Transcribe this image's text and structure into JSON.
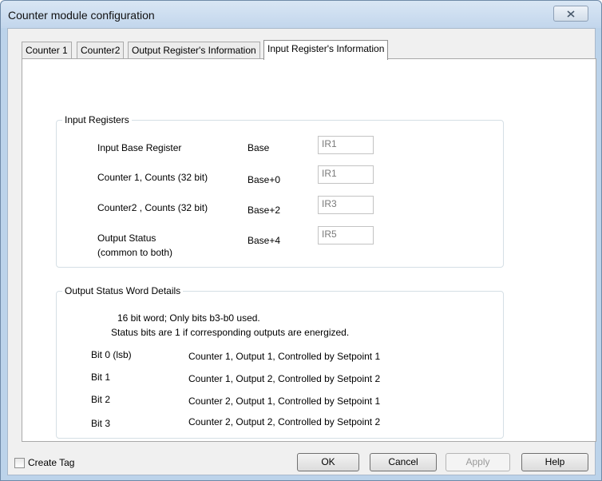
{
  "window": {
    "title": "Counter module configuration"
  },
  "tabs": [
    {
      "label": "Counter 1"
    },
    {
      "label": "Counter2"
    },
    {
      "label": "Output Register's Information"
    },
    {
      "label": "Input Register's Information"
    }
  ],
  "input_registers": {
    "legend": "Input Registers",
    "rows": [
      {
        "label": "Input Base Register",
        "offset": "Base",
        "value": "IR1"
      },
      {
        "label": "Counter 1, Counts (32 bit)",
        "offset": "Base+0",
        "value": "IR1"
      },
      {
        "label": "Counter2 , Counts (32 bit)",
        "offset": "Base+2",
        "value": "IR3"
      },
      {
        "label": "Output Status",
        "sublabel": "(common to both)",
        "offset": "Base+4",
        "value": "IR5"
      }
    ]
  },
  "output_status": {
    "legend": "Output Status Word Details",
    "desc_line1": "16 bit word; Only bits b3-b0 used.",
    "desc_line2": "Status bits are 1 if corresponding outputs are energized.",
    "bits": [
      {
        "bit": "Bit 0 (lsb)",
        "desc": "Counter 1, Output 1, Controlled by Setpoint 1"
      },
      {
        "bit": "Bit 1",
        "desc": "Counter 1, Output 2, Controlled by Setpoint 2"
      },
      {
        "bit": "Bit 2",
        "desc": "Counter 2, Output 1, Controlled by Setpoint 1"
      },
      {
        "bit": "Bit 3",
        "desc": "Counter 2, Output 2, Controlled by Setpoint 2"
      }
    ]
  },
  "footer": {
    "create_tag_label": "Create Tag",
    "create_tag_checked": false,
    "ok_label": "OK",
    "cancel_label": "Cancel",
    "apply_label": "Apply",
    "apply_enabled": false,
    "help_label": "Help"
  },
  "icons": {
    "close": "close-icon"
  }
}
